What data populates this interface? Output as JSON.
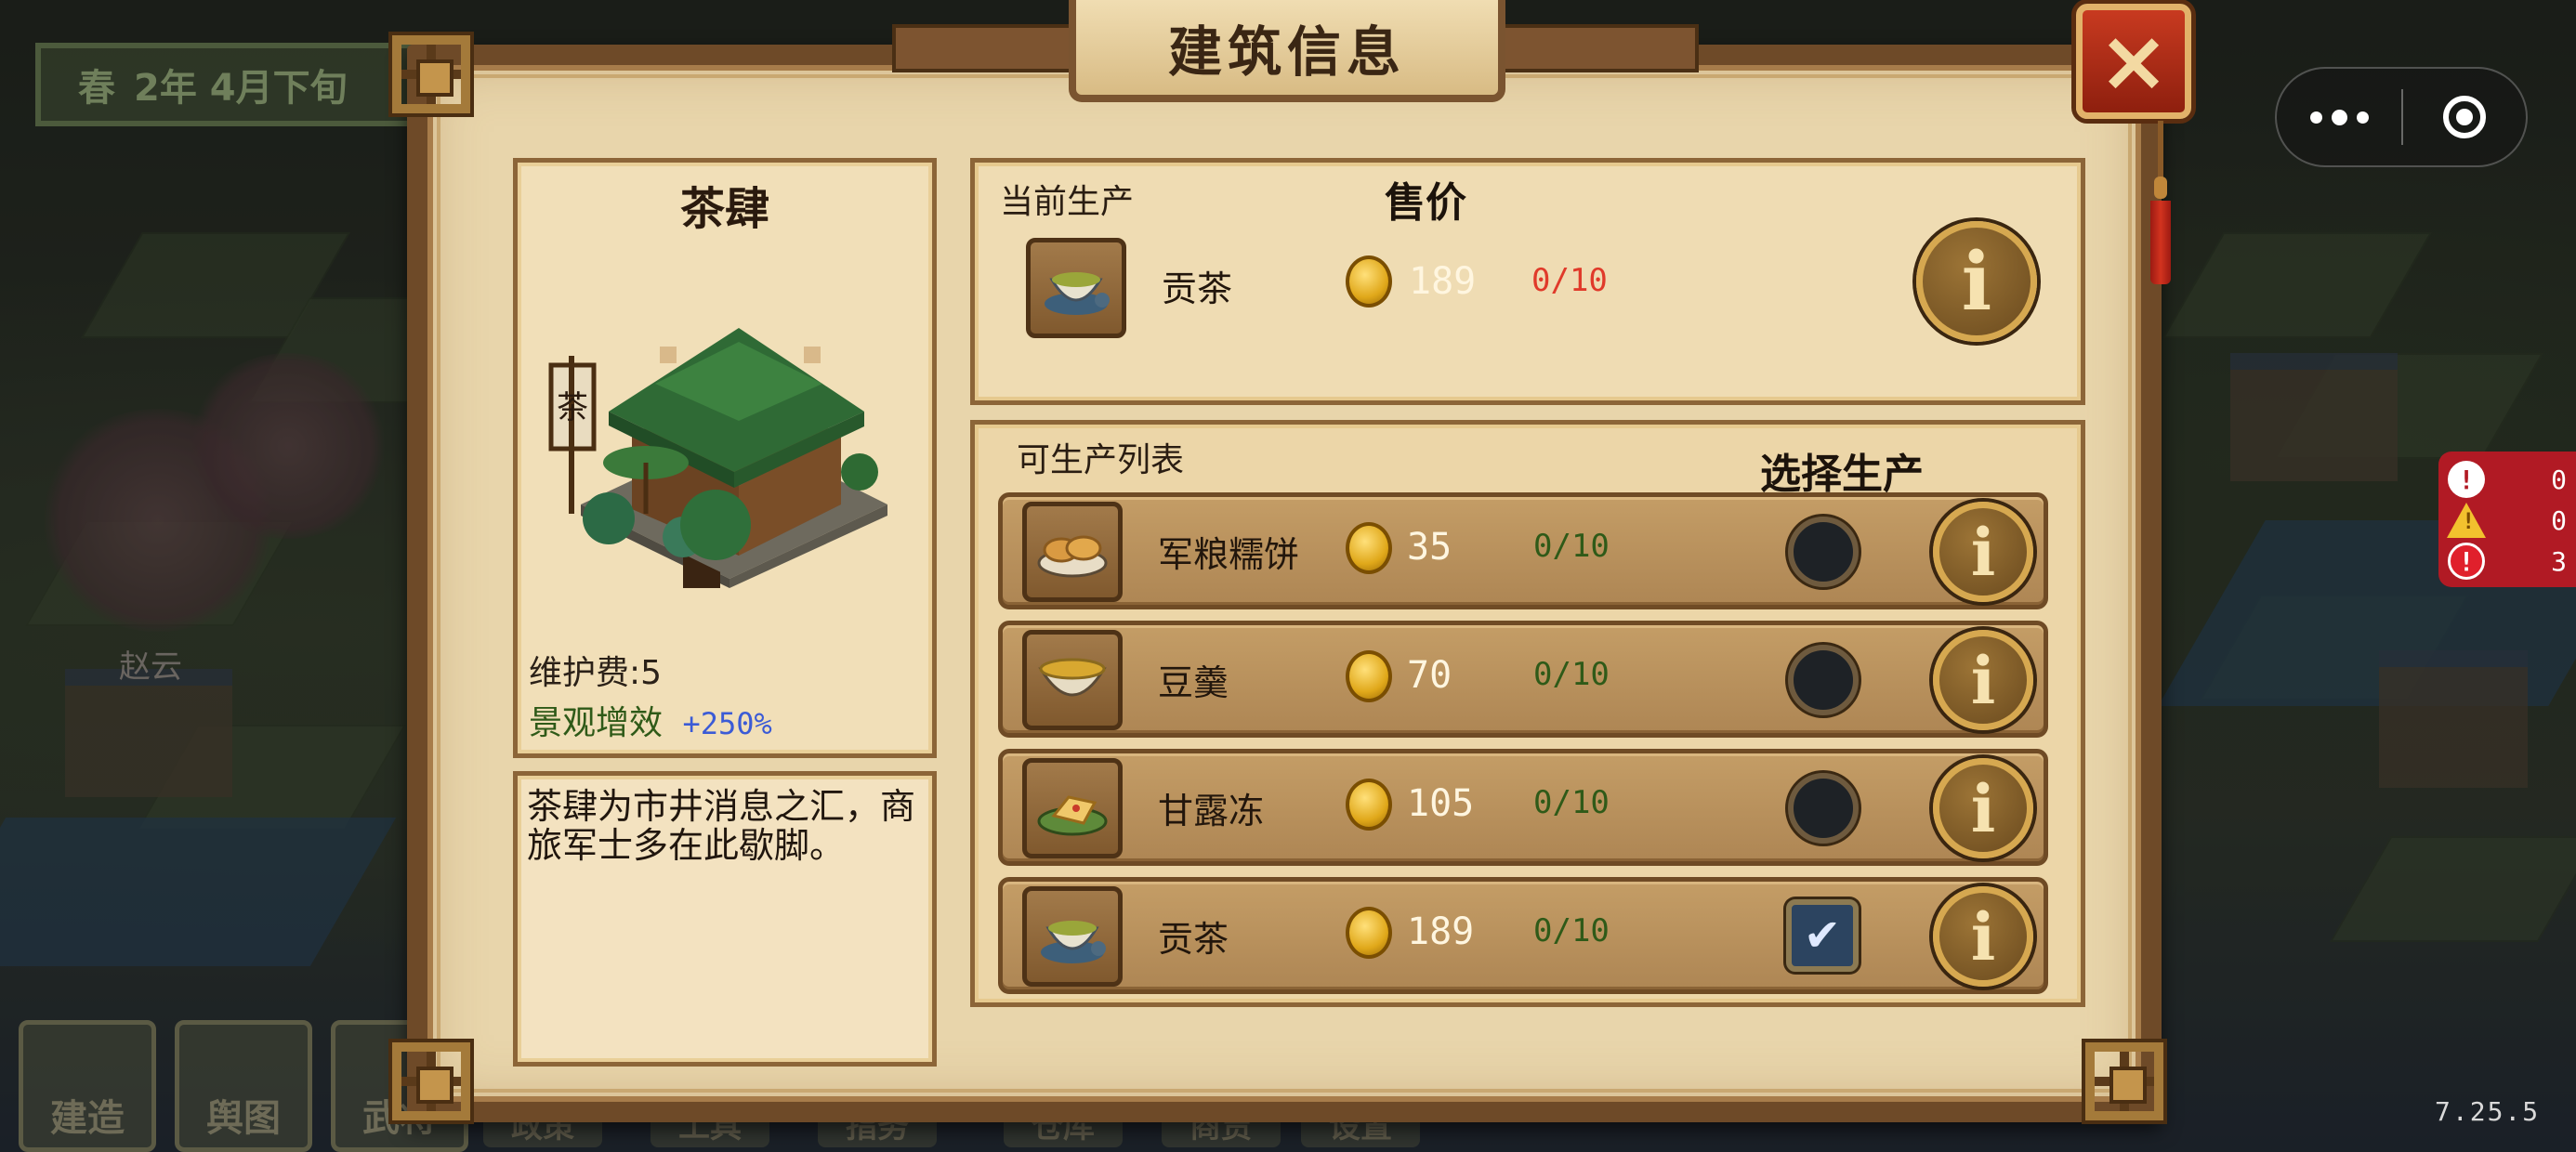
{
  "hud": {
    "season": "春",
    "date": "2年 4月下旬",
    "npc_name": "赵云",
    "bottom_buttons": [
      "建造",
      "舆图",
      "武将"
    ],
    "bottom_tabs": [
      "政策",
      "工具",
      "指务",
      "仓库",
      "商贾",
      "设置"
    ],
    "version": "7.25.5"
  },
  "error_counter": {
    "info": "0",
    "warn": "0",
    "error": "3"
  },
  "dialog": {
    "title": "建筑信息",
    "close_label": "×",
    "building": {
      "name": "茶肆",
      "sign_char": "茶",
      "upkeep": "维护费:5",
      "scenic_label": "景观增效",
      "scenic_value": "+250%",
      "description": "茶肆为市井消息之汇，商旅军士多在此歇脚。"
    },
    "current": {
      "label": "当前生产",
      "price_header": "售价",
      "item": {
        "name": "贡茶",
        "price": "189",
        "qty": "0/10"
      }
    },
    "list": {
      "label": "可生产列表",
      "select_header": "选择生产",
      "items": [
        {
          "name": "军粮糯饼",
          "price": "35",
          "qty": "0/10",
          "selected": false
        },
        {
          "name": "豆羹",
          "price": "70",
          "qty": "0/10",
          "selected": false
        },
        {
          "name": "甘露冻",
          "price": "105",
          "qty": "0/10",
          "selected": false
        },
        {
          "name": "贡茶",
          "price": "189",
          "qty": "0/10",
          "selected": true
        }
      ]
    },
    "info_label": "i",
    "check_mark": "✔"
  },
  "colors": {
    "qty_current": "#e03a2a",
    "qty_list": "#2f5a18",
    "scenic_label": "#2f5a18",
    "scenic_value": "#3b5bd6"
  }
}
